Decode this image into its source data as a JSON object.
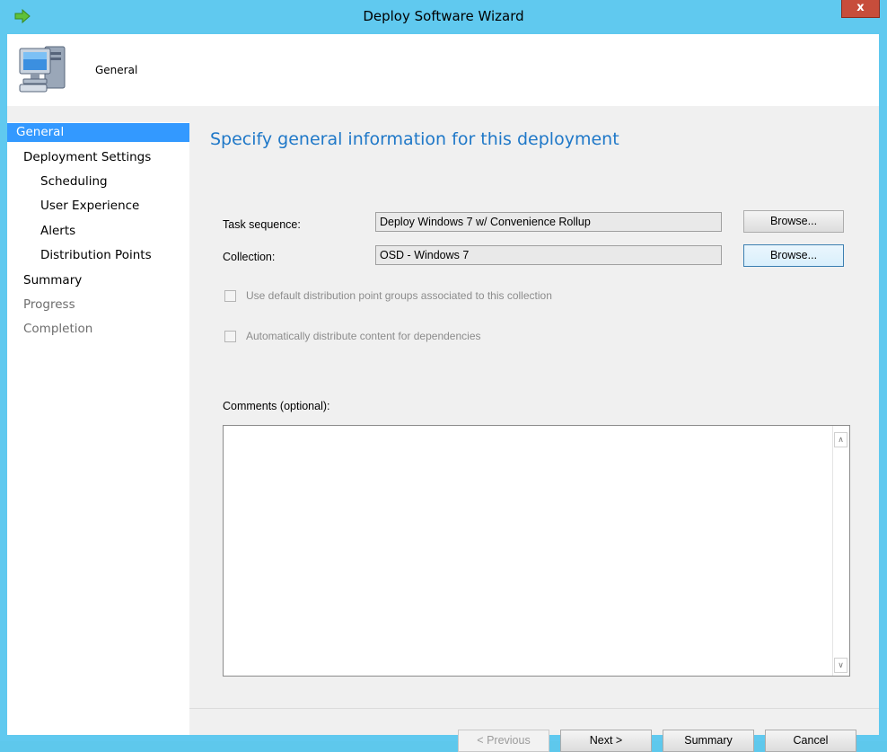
{
  "window": {
    "title": "Deploy Software Wizard",
    "close_label": "x",
    "icons": {
      "title": "green-arrow-icon",
      "header": "computer-icon"
    }
  },
  "header": {
    "title": "General"
  },
  "sidebar": {
    "items": [
      {
        "label": "General",
        "state": "selected"
      },
      {
        "label": "Deployment Settings",
        "state": "normal"
      },
      {
        "label": "Scheduling",
        "state": "normal"
      },
      {
        "label": "User Experience",
        "state": "normal"
      },
      {
        "label": "Alerts",
        "state": "normal"
      },
      {
        "label": "Distribution Points",
        "state": "normal"
      },
      {
        "label": "Summary",
        "state": "normal"
      },
      {
        "label": "Progress",
        "state": "disabled"
      },
      {
        "label": "Completion",
        "state": "disabled"
      }
    ]
  },
  "main": {
    "heading": "Specify general information for this deployment",
    "task_sequence": {
      "label": "Task sequence:",
      "value": "Deploy Windows 7 w/ Convenience Rollup",
      "browse": "Browse..."
    },
    "collection": {
      "label": "Collection:",
      "value": "OSD - Windows 7",
      "browse": "Browse..."
    },
    "options": [
      {
        "label": "Use default distribution point groups associated to this collection",
        "checked": false,
        "enabled": false
      },
      {
        "label": "Automatically distribute content for dependencies",
        "checked": false,
        "enabled": false
      }
    ],
    "comments": {
      "label": "Comments (optional):",
      "value": ""
    }
  },
  "footer": {
    "previous": "< Previous",
    "next": "Next >",
    "summary": "Summary",
    "cancel": "Cancel"
  },
  "colors": {
    "accent": "#1f78c8",
    "selection": "#3399ff",
    "frame": "#60c9ef"
  }
}
